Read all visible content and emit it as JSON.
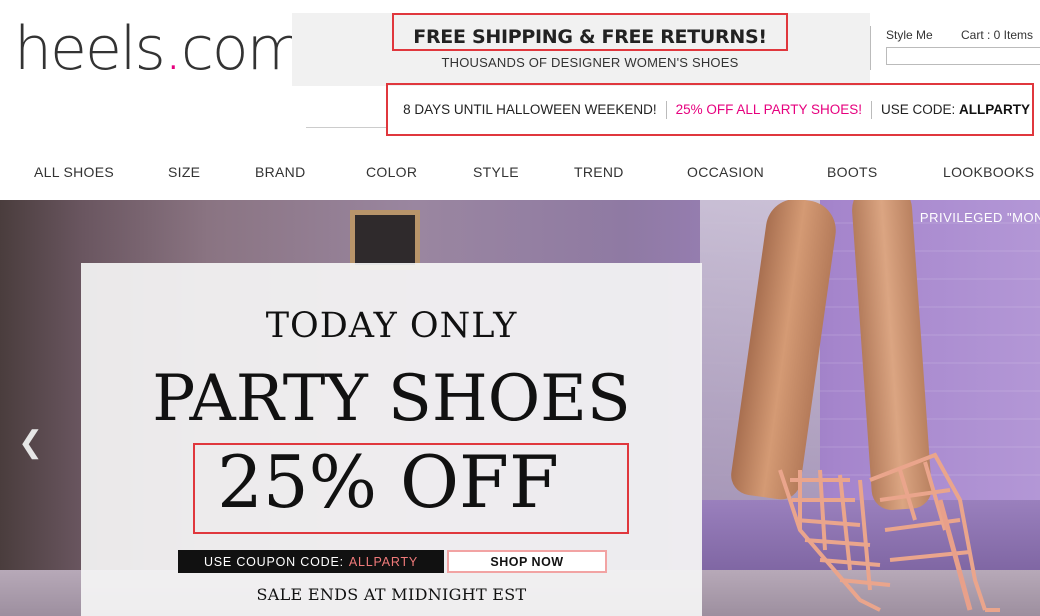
{
  "logo": {
    "text": "heels",
    "dot": ".",
    "suffix": "com"
  },
  "header": {
    "shipping_title": "FREE SHIPPING & FREE RETURNS!",
    "shipping_sub": "THOUSANDS OF DESIGNER WOMEN'S SHOES",
    "style_me": "Style Me",
    "cart": "Cart : 0 Items"
  },
  "promo": {
    "days": "8 DAYS UNTIL HALLOWEEN WEEKEND!",
    "discount": "25% OFF ALL PARTY SHOES!",
    "code_label": "USE CODE:",
    "code": "ALLPARTY"
  },
  "nav": [
    "ALL SHOES",
    "SIZE",
    "BRAND",
    "COLOR",
    "STYLE",
    "TREND",
    "OCCASION",
    "BOOTS",
    "LOOKBOOKS"
  ],
  "hero": {
    "corner_text": "PRIVILEGED \"MON",
    "today": "TODAY ONLY",
    "headline": "PARTY SHOES",
    "offer": "25% OFF",
    "coupon_label": "USE COUPON CODE:",
    "coupon_code": "ALLPARTY",
    "shop_now": "SHOP NOW",
    "sale_ends": "SALE ENDS AT MIDNIGHT EST"
  },
  "colors": {
    "accent_pink": "#e6007e",
    "highlight_red": "#e0373d"
  }
}
